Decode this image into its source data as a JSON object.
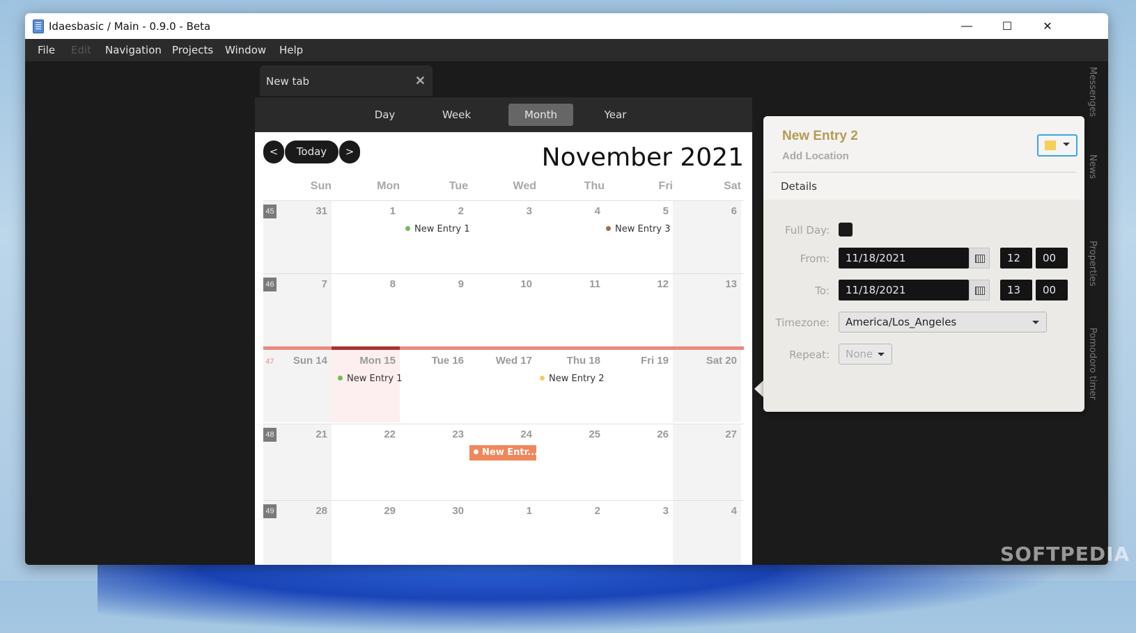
{
  "window": {
    "title": "Idaesbasic / Main - 0.9.0 - Beta",
    "controls": {
      "minimize": "—",
      "maximize": "☐",
      "close": "✕"
    }
  },
  "menu": [
    "File",
    "Edit",
    "Navigation",
    "Projects",
    "Window",
    "Help"
  ],
  "tab": {
    "label": "New tab",
    "close": "✕"
  },
  "views": [
    "Day",
    "Week",
    "Month",
    "Year"
  ],
  "active_view": "Month",
  "calendar": {
    "prev": "<",
    "today": "Today",
    "next": ">",
    "month_title": "November 2021",
    "days_of_week": [
      "Sun",
      "Mon",
      "Tue",
      "Wed",
      "Thu",
      "Fri",
      "Sat"
    ],
    "weeks": [
      {
        "week_number": "45",
        "days": [
          "31",
          "1",
          "2",
          "3",
          "4",
          "5",
          "6"
        ]
      },
      {
        "week_number": "46",
        "days": [
          "7",
          "8",
          "9",
          "10",
          "11",
          "12",
          "13"
        ]
      },
      {
        "week_number": "47",
        "days": [
          "Sun 14",
          "Mon 15",
          "Tue 16",
          "Wed 17",
          "Thu 18",
          "Fri 19",
          "Sat 20"
        ]
      },
      {
        "week_number": "48",
        "days": [
          "21",
          "22",
          "23",
          "24",
          "25",
          "26",
          "27"
        ]
      },
      {
        "week_number": "49",
        "days": [
          "28",
          "29",
          "30",
          "1",
          "2",
          "3",
          "4"
        ]
      }
    ],
    "entries": {
      "w45_mon": {
        "label": "New Entry 1",
        "color": "#6cbf4f"
      },
      "w45_fri": {
        "label": "New Entry 3",
        "color": "#a86a45"
      },
      "w47_mon": {
        "label": "New Entry 1",
        "color": "#6cbf4f"
      },
      "w47_thu": {
        "label": "New Entry 2",
        "color": "#f5cf5a"
      },
      "w48_wed": {
        "label": "New Entr...",
        "color": "#f0875b"
      }
    }
  },
  "side_tabs": [
    "Messenges",
    "News",
    "Properties",
    "Pomodoro timer"
  ],
  "popover": {
    "title": "New Entry 2",
    "add_location": "Add Location",
    "entry_color": "#f5cf5a",
    "details": "Details",
    "full_day_label": "Full Day:",
    "from_label": "From:",
    "from_date": "11/18/2021",
    "from_hour": "12",
    "from_minute": "00",
    "to_label": "To:",
    "to_date": "11/18/2021",
    "to_hour": "13",
    "to_minute": "00",
    "timezone_label": "Timezone:",
    "timezone": "America/Los_Angeles",
    "repeat_label": "Repeat:",
    "repeat": "None"
  },
  "watermark": "SOFTPEDIA"
}
